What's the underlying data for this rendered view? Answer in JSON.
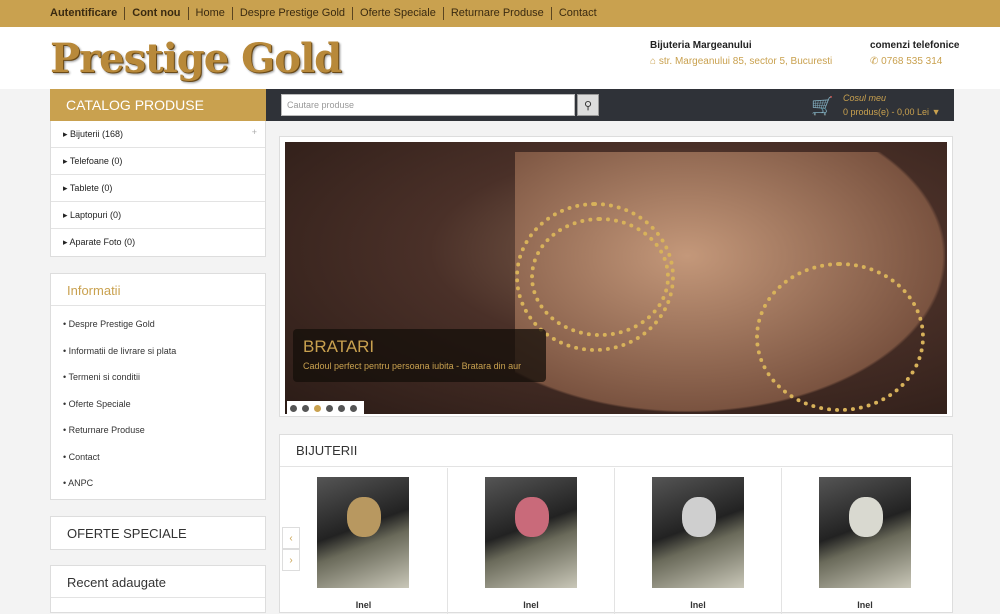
{
  "topnav": {
    "items": [
      "Autentificare",
      "Cont nou",
      "Home",
      "Despre Prestige Gold",
      "Oferte Speciale",
      "Returnare Produse",
      "Contact"
    ]
  },
  "logo": "Prestige Gold",
  "shop": {
    "name": "Bijuteria Margeanului",
    "address": "str. Margeanului 85, sector 5, Bucuresti"
  },
  "phone": {
    "title": "comenzi telefonice",
    "number": "0768 535 314"
  },
  "catalog": {
    "title": "CATALOG PRODUSE",
    "items": [
      "Bijuterii (168)",
      "Telefoane (0)",
      "Tablete (0)",
      "Laptopuri (0)",
      "Aparate Foto (0)"
    ]
  },
  "search": {
    "placeholder": "Cautare produse"
  },
  "cart": {
    "title": "Cosul meu",
    "value": "0 produs(e) - 0,00 Lei"
  },
  "info": {
    "title": "Informatii",
    "items": [
      "Despre Prestige Gold",
      "Informatii de livrare si plata",
      "Termeni si conditii",
      "Oferte Speciale",
      "Returnare Produse",
      "Contact",
      "ANPC"
    ]
  },
  "offers": {
    "title": "OFERTE SPECIALE"
  },
  "recent": {
    "title": "Recent adaugate"
  },
  "banner": {
    "title": "BRATARI",
    "subtitle": "Cadoul perfect pentru persoana iubita - Bratara din aur",
    "active_slide": 3,
    "slides": 6
  },
  "products": {
    "title": "BIJUTERII",
    "items": [
      "Inel",
      "Inel",
      "Inel",
      "Inel"
    ]
  },
  "colors": {
    "gold": "#c9a14f",
    "dark": "#2f3238"
  }
}
